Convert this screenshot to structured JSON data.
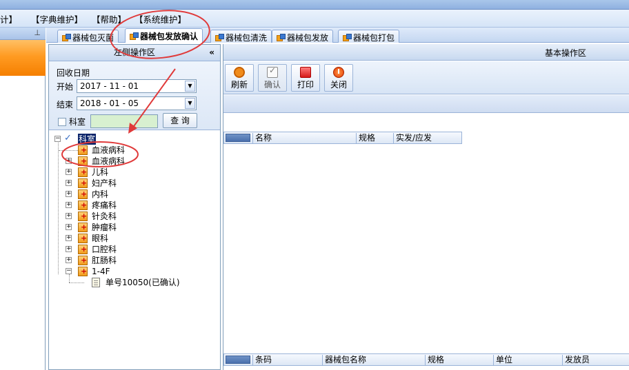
{
  "menu": {
    "items": [
      "计】",
      "【字典维护】",
      "【帮助】",
      "【系统维护】"
    ]
  },
  "tabs": [
    {
      "label": "器械包灭菌"
    },
    {
      "label": "器械包发放确认",
      "active": true
    },
    {
      "label": "器械包清洗"
    },
    {
      "label": "器械包发放"
    },
    {
      "label": "器械包打包"
    }
  ],
  "left_panel": {
    "title": "左侧操作区",
    "collapse_glyph": "«",
    "recv_date_label": "回收日期",
    "start_label": "开始",
    "start_date": "2017 - 11 - 01",
    "end_label": "结束",
    "end_date": "2018 - 01 - 05",
    "dept_label": "科室",
    "query_button": "查  询"
  },
  "tree": {
    "root": "科室",
    "nodes": [
      "血液病科",
      "血液病科",
      "儿科",
      "妇产科",
      "内科",
      "疼痛科",
      "针灸科",
      "肿瘤科",
      "眼科",
      "口腔科",
      "肛肠科",
      "1-4F"
    ],
    "leaf": "单号10050(已确认)"
  },
  "right": {
    "title": "基本操作区",
    "toolbar": [
      "刷新",
      "确认",
      "打印",
      "关闭"
    ],
    "top_grid_columns": [
      "名称",
      "规格",
      "实发/应发"
    ],
    "bottom_grid_columns": [
      "条码",
      "器械包名称",
      "规格",
      "单位",
      "发放员"
    ]
  },
  "colors": {
    "annotation": "#e03a3a",
    "tree_selection": "#0a246a",
    "orange_band": "#ff9b22"
  }
}
